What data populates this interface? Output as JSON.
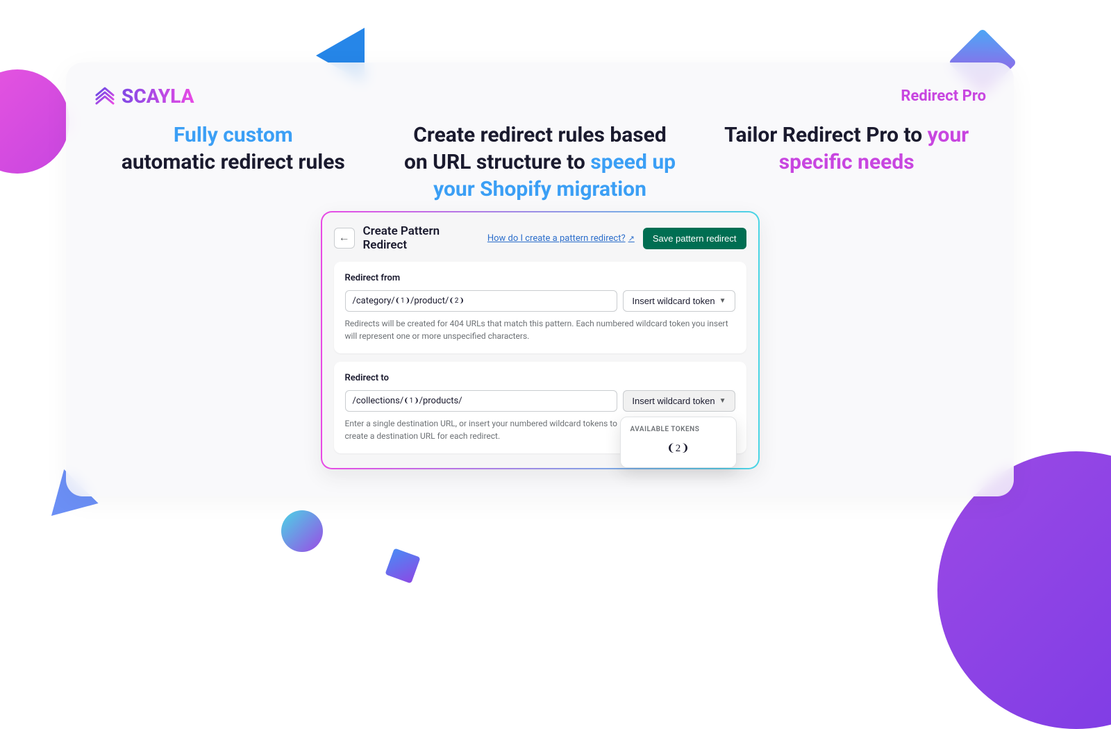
{
  "brand": {
    "name": "SCAYLA"
  },
  "app": {
    "name": "Redirect Pro"
  },
  "headlines": {
    "col1": {
      "line1": "Fully custom",
      "line2": "automatic redirect rules"
    },
    "col2": {
      "line1": "Create redirect rules based on URL structure to ",
      "highlight": "speed up your Shopify migration"
    },
    "col3": {
      "line1": "Tailor Redirect Pro to ",
      "highlight": "your specific needs"
    }
  },
  "panel": {
    "title": "Create Pattern Redirect",
    "helpLink": "How do I create a pattern redirect?",
    "saveButton": "Save pattern redirect",
    "redirectFrom": {
      "label": "Redirect from",
      "prefix": "/category/",
      "mid": "/product/",
      "token1": "1",
      "token2": "2",
      "insertButton": "Insert wildcard token",
      "helper": "Redirects will be created for 404 URLs that match this pattern. Each numbered wildcard token you insert will represent one or more unspecified characters."
    },
    "redirectTo": {
      "label": "Redirect to",
      "prefix": "/collections/",
      "suffix": "/products/",
      "token1": "1",
      "insertButton": "Insert wildcard token",
      "helper": "Enter a single destination URL, or insert your numbered wildcard tokens to create a destination URL for each redirect."
    },
    "popover": {
      "label": "AVAILABLE TOKENS",
      "token": "❨2❩"
    }
  }
}
